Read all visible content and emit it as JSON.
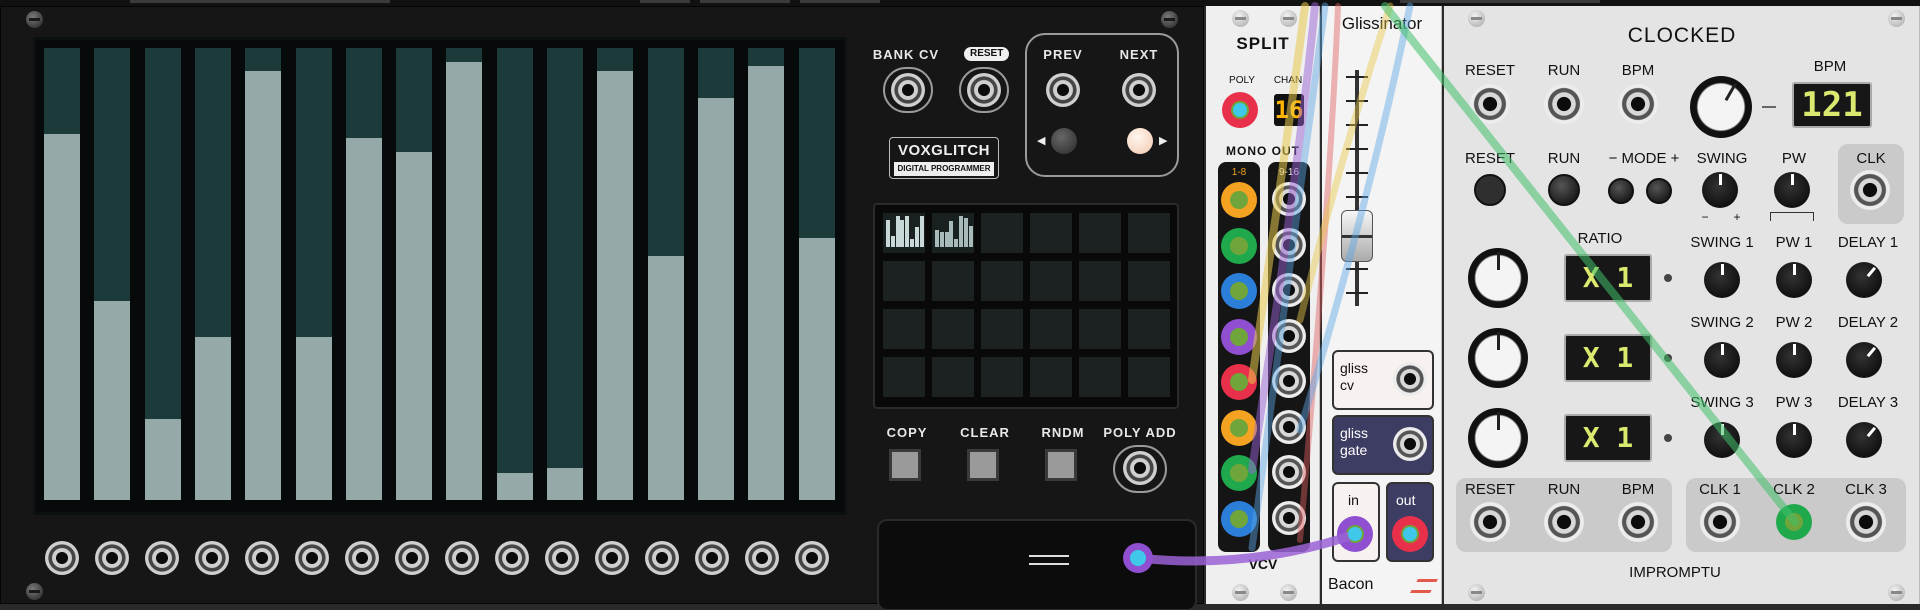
{
  "voxglitch": {
    "bank_cv_label": "BANK CV",
    "reset_label": "RESET",
    "prev_label": "PREV",
    "next_label": "NEXT",
    "logo_text": "VOXGLITCH",
    "logo_sub": "DIGITAL PROGRAMMER",
    "copy_label": "COPY",
    "clear_label": "CLEAR",
    "rndm_label": "RNDM",
    "poly_add_label": "POLY ADD",
    "slider_levels": [
      0.81,
      0.44,
      0.18,
      0.36,
      0.95,
      0.36,
      0.8,
      0.77,
      0.97,
      0.06,
      0.07,
      0.95,
      0.54,
      0.89,
      0.96,
      0.58
    ]
  },
  "split": {
    "title": "SPLIT",
    "poly_label": "POLY",
    "chan_label": "CHAN",
    "chan_value": "16",
    "mono_out_label": "MONO OUT",
    "range_a": "1-8",
    "range_b": "9-16",
    "brand": "VCV",
    "port_colors": [
      "#f3a321",
      "#1fa94c",
      "#2b7fd8",
      "#8f4fd0",
      "#e8304a",
      "#f3a321",
      "#1fa94c",
      "#2b7fd8"
    ]
  },
  "glissinator": {
    "title": "Glissinator",
    "gliss_cv_label": "gliss cv",
    "gliss_gate_label": "gliss gate",
    "in_label": "in",
    "out_label": "out",
    "brand": "Bacon"
  },
  "clocked": {
    "title": "CLOCKED",
    "brand": "IMPROMPTU",
    "bpm_value": "121",
    "ratio_value": "X 1",
    "top_row": [
      "RESET",
      "RUN",
      "BPM"
    ],
    "bpm_label": "BPM",
    "row2": [
      "RESET",
      "RUN",
      "− MODE +",
      "SWING",
      "PW",
      "CLK"
    ],
    "swing_minus": "−",
    "swing_plus": "+",
    "ratio_label": "RATIO",
    "sub_rows": [
      [
        "SWING 1",
        "PW 1",
        "DELAY 1"
      ],
      [
        "SWING 2",
        "PW 2",
        "DELAY 2"
      ],
      [
        "SWING 3",
        "PW 3",
        "DELAY 3"
      ]
    ],
    "bottom_left": [
      "RESET",
      "RUN",
      "BPM"
    ],
    "bottom_right": [
      "CLK 1",
      "CLK 2",
      "CLK 3"
    ]
  },
  "colors": {
    "cable_yellow": "#e6c84a",
    "cable_purple": "#9a62d6",
    "cable_green": "#3fbf6a",
    "cable_blue": "#5aa6e6",
    "cable_red": "#e06060"
  }
}
